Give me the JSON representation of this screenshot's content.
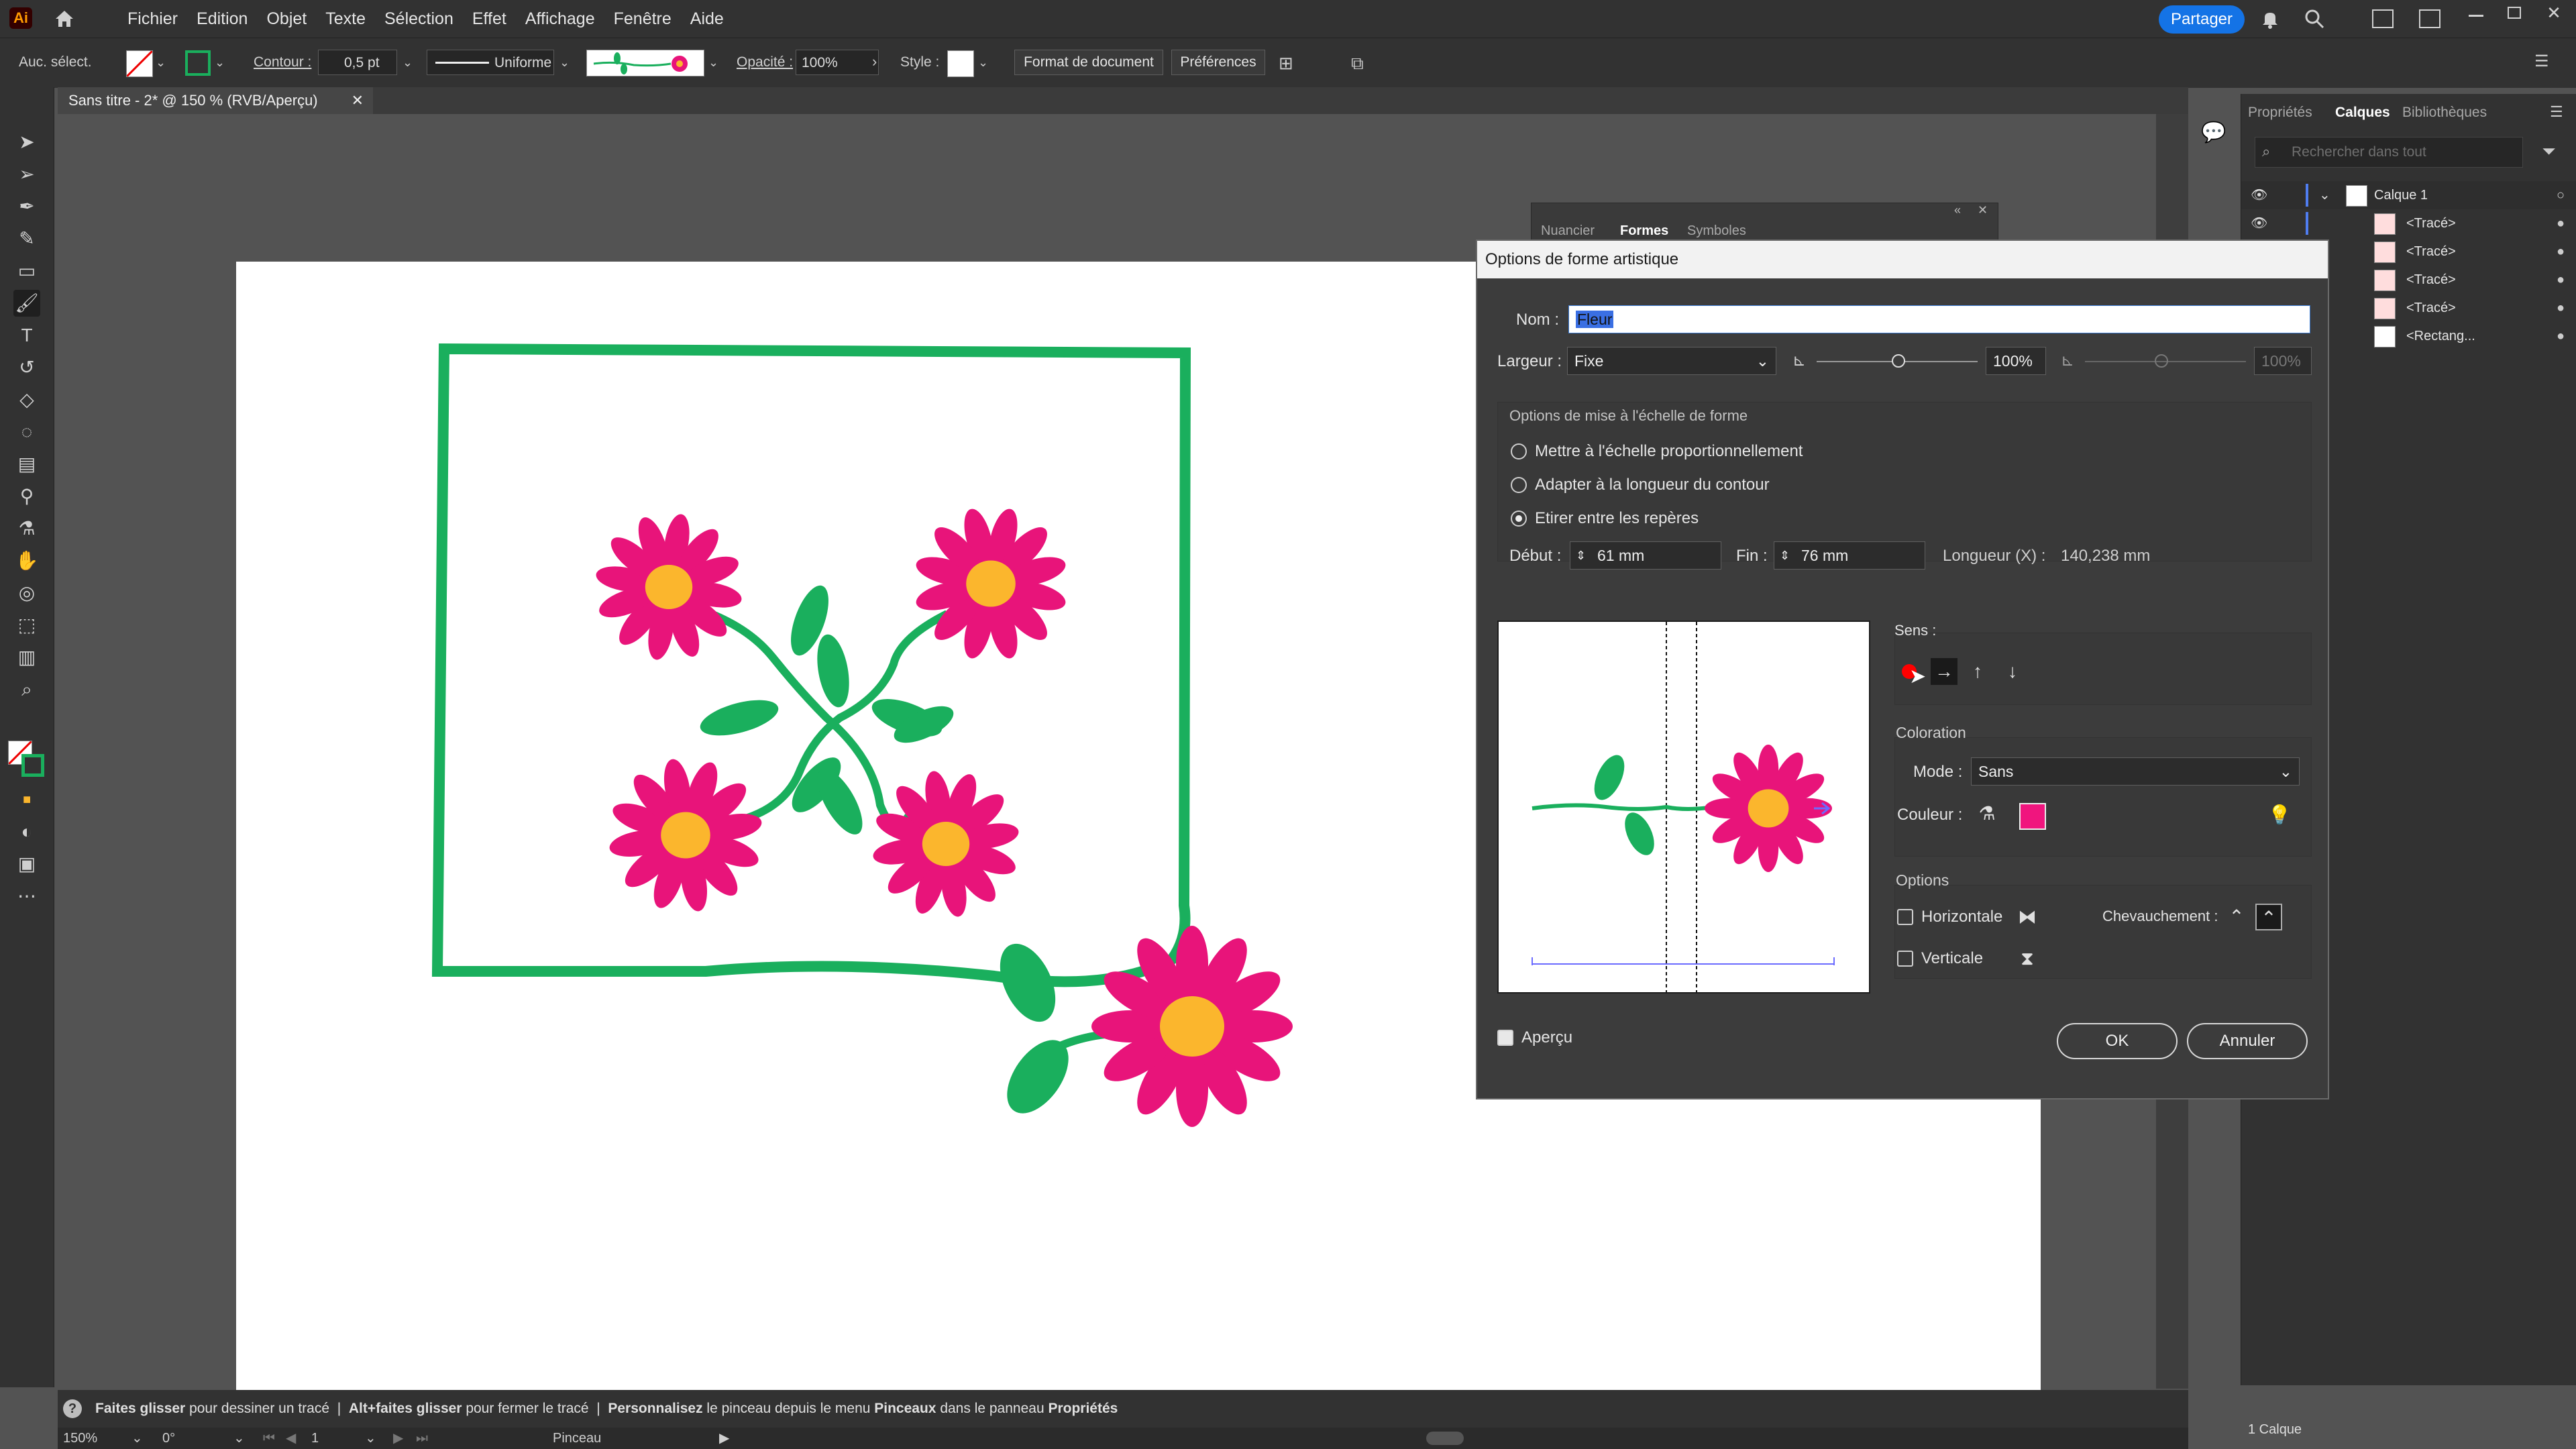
{
  "app": {
    "logo": "Ai",
    "menus": [
      "Fichier",
      "Edition",
      "Objet",
      "Texte",
      "Sélection",
      "Effet",
      "Affichage",
      "Fenêtre",
      "Aide"
    ],
    "share_label": "Partager"
  },
  "control": {
    "selection_label": "Auc. sélect.",
    "stroke_label": "Contour :",
    "stroke_value": "0,5 pt",
    "profile_label": "Uniforme",
    "opacity_label": "Opacité :",
    "opacity_value": "100%",
    "style_label": "Style :",
    "doc_format_button": "Format de document",
    "prefs_button": "Préférences"
  },
  "document": {
    "tab_title": "Sans titre - 2* @ 150 % (RVB/Aperçu)"
  },
  "panels": {
    "tabs": [
      "Propriétés",
      "Calques",
      "Bibliothèques"
    ],
    "active_tab": "Calques",
    "search_placeholder": "Rechercher dans tout",
    "layer_name": "Calque 1",
    "items": [
      "<Tracé>",
      "<Tracé>",
      "<Tracé>",
      "<Tracé>",
      "<Rectang..."
    ],
    "footer_count": "1 Calque"
  },
  "floating_panel": {
    "tabs": [
      "Nuancier",
      "Formes",
      "Symboles"
    ],
    "active": "Formes"
  },
  "dialog": {
    "title": "Options de forme artistique",
    "name_label": "Nom :",
    "name_value": "Fleur",
    "width_label": "Largeur :",
    "width_mode": "Fixe",
    "width_percent": "100%",
    "width_percent_disabled": "100%",
    "scale_group_title": "Options de mise à l'échelle de forme",
    "scale_options": [
      "Mettre à l'échelle proportionnellement",
      "Adapter à la longueur du contour",
      "Etirer entre les repères"
    ],
    "scale_selected_index": 2,
    "start_label": "Début :",
    "start_value": "61 mm",
    "end_label": "Fin :",
    "end_value": "76 mm",
    "length_label": "Longueur (X) :",
    "length_value": "140,238 mm",
    "direction_label": "Sens :",
    "coloration_title": "Coloration",
    "mode_label": "Mode :",
    "mode_value": "Sans",
    "color_label": "Couleur :",
    "color_swatch": "#f0157e",
    "options_title": "Options",
    "flip_horizontal": "Horizontale",
    "flip_vertical": "Verticale",
    "overlap_label": "Chevauchement :",
    "preview_label": "Aperçu",
    "ok_button": "OK",
    "cancel_button": "Annuler"
  },
  "status": {
    "tip_part1_bold": "Faites glisser",
    "tip_part1": " pour dessiner un tracé  |  ",
    "tip_part2_bold": "Alt+faites glisser",
    "tip_part2": " pour fermer le tracé  |  ",
    "tip_part3_bold": "Personnalisez",
    "tip_part3": " le pinceau depuis le menu ",
    "tip_part4_bold": "Pinceaux",
    "tip_part4": " dans le panneau ",
    "tip_part5_bold": "Propriétés",
    "zoom": "150%",
    "rotation": "0°",
    "artboard_number": "1",
    "current_tool": "Pinceau"
  },
  "colors": {
    "flower_petal": "#e8147a",
    "flower_center": "#fbb62d",
    "stem_green": "#1aaf5d",
    "accent_blue": "#1473e6"
  }
}
